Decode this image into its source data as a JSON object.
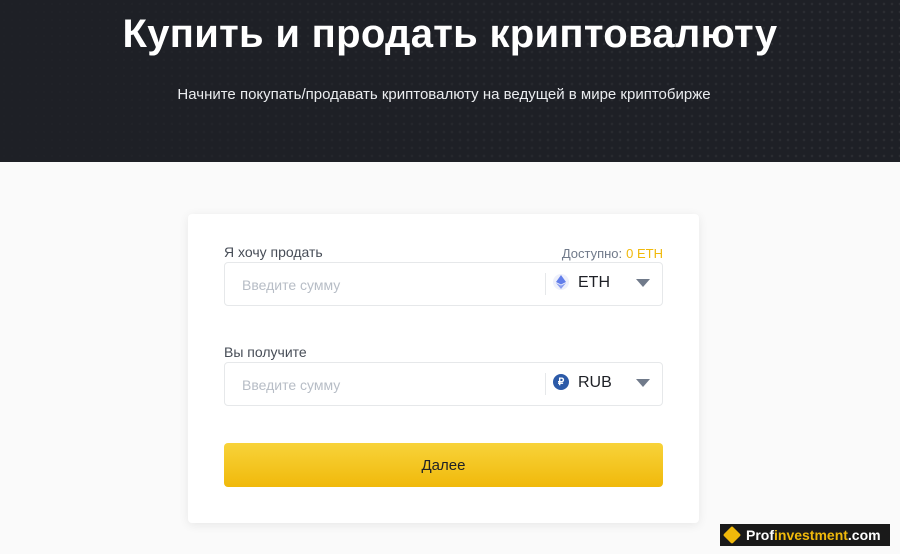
{
  "hero": {
    "title": "Купить и продать криптовалюту",
    "subtitle": "Начните покупать/продавать криптовалюту на ведущей в мире криптобирже"
  },
  "form": {
    "sell": {
      "label": "Я хочу продать",
      "available_label": "Доступно:",
      "available_value": "0 ETH",
      "placeholder": "Введите сумму",
      "currency": "ETH",
      "currency_icon": "ethereum-icon"
    },
    "receive": {
      "label": "Вы получите",
      "placeholder": "Введите сумму",
      "currency": "RUB",
      "currency_icon": "ruble-icon",
      "currency_icon_glyph": "₽"
    },
    "submit_label": "Далее"
  },
  "watermark": {
    "text_prefix": "Prof",
    "text_accent": "investment",
    "text_suffix": ".com"
  },
  "colors": {
    "accent": "#f0b90b",
    "hero_bg": "#1e2026",
    "button_top": "#f8d33a"
  }
}
